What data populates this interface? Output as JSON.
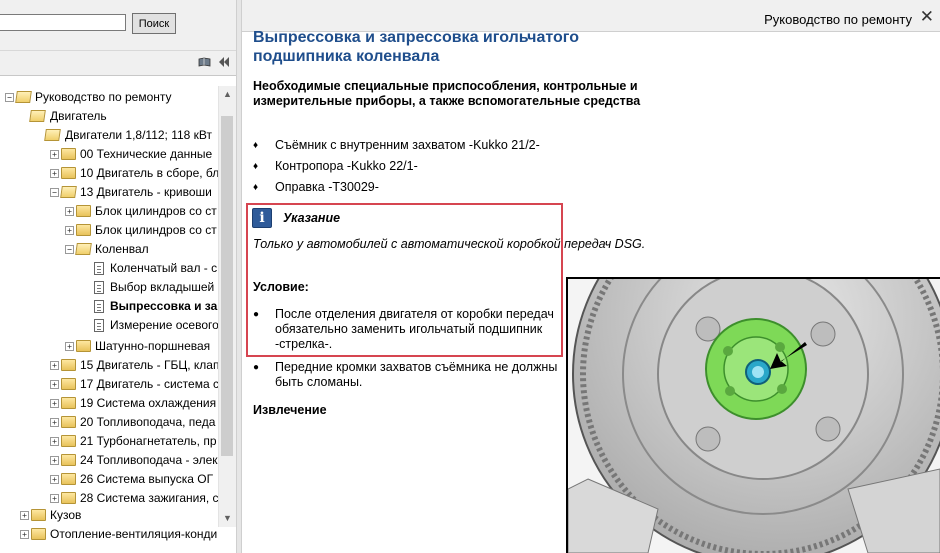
{
  "search": {
    "placeholder": "",
    "button_label": "Поиск"
  },
  "tree": {
    "items": [
      {
        "label": "Руководство по ремонту",
        "expander": "−"
      },
      {
        "label": "Двигатель",
        "expander": ""
      },
      {
        "label": "Двигатели 1,8/112; 118 кВт",
        "expander": ""
      },
      {
        "label": "00 Технические данные",
        "expander": "+"
      },
      {
        "label": "10 Двигатель в сборе, бл",
        "expander": "+"
      },
      {
        "label": "13 Двигатель - кривоши",
        "expander": "−"
      },
      {
        "label": "Блок цилиндров со ст",
        "expander": "+"
      },
      {
        "label": "Блок цилиндров со ст",
        "expander": "+"
      },
      {
        "label": "Коленвал",
        "expander": "−"
      },
      {
        "label": "Коленчатый вал - с",
        "expander": ""
      },
      {
        "label": "Выбор вкладышей",
        "expander": ""
      },
      {
        "label": "Выпрессовка и зап",
        "expander": ""
      },
      {
        "label": "Измерение осевого",
        "expander": ""
      },
      {
        "label": "Шатунно-поршневая",
        "expander": "+"
      },
      {
        "label": "15 Двигатель - ГБЦ, клап",
        "expander": "+"
      },
      {
        "label": "17 Двигатель - система с",
        "expander": "+"
      },
      {
        "label": "19 Система охлаждения",
        "expander": "+"
      },
      {
        "label": "20 Топливоподача, педа",
        "expander": "+"
      },
      {
        "label": "21 Турбонагнетатель, пр",
        "expander": "+"
      },
      {
        "label": "24 Топливоподача - элек",
        "expander": "+"
      },
      {
        "label": "26 Система выпуска ОГ",
        "expander": "+"
      },
      {
        "label": "28 Система зажигания, с",
        "expander": "+"
      },
      {
        "label": "Кузов",
        "expander": "+"
      },
      {
        "label": "Отопление-вентиляция-конди",
        "expander": "+"
      }
    ]
  },
  "header": {
    "title": "Руководство по ремонту",
    "close_glyph": "✕"
  },
  "document": {
    "title": "Выпрессовка и запрессовка игольчатого подшипника коленвала",
    "tools_heading": "Необходимые специальные приспособления, контрольные и измерительные приборы, а также вспомогательные средства",
    "tools": [
      "Съёмник с внутренним захватом -Kukko 21/2-",
      "Контропора -Kukko 22/1-",
      "Оправка -T30029-"
    ],
    "note": {
      "icon": "i",
      "title": "Указание",
      "text": "Только у автомобилей с автоматической коробкой передач DSG."
    },
    "condition_heading": "Условие:",
    "conditions": [
      "После отделения двигателя от коробки передач обязательно заменить игольчатый подшипник -стрелка-.",
      "Передние кромки захватов съёмника не должны быть сломаны."
    ],
    "removal_heading": "Извлечение"
  },
  "colors": {
    "title_blue": "#1f4e8c",
    "highlight_red": "#d64550",
    "info_blue": "#2f5b9a",
    "bearing_green": "#7ed957"
  },
  "icons": {
    "book": "book-icon",
    "collapse": "double-chevron-left-icon",
    "info": "info-icon",
    "close": "close-icon"
  }
}
